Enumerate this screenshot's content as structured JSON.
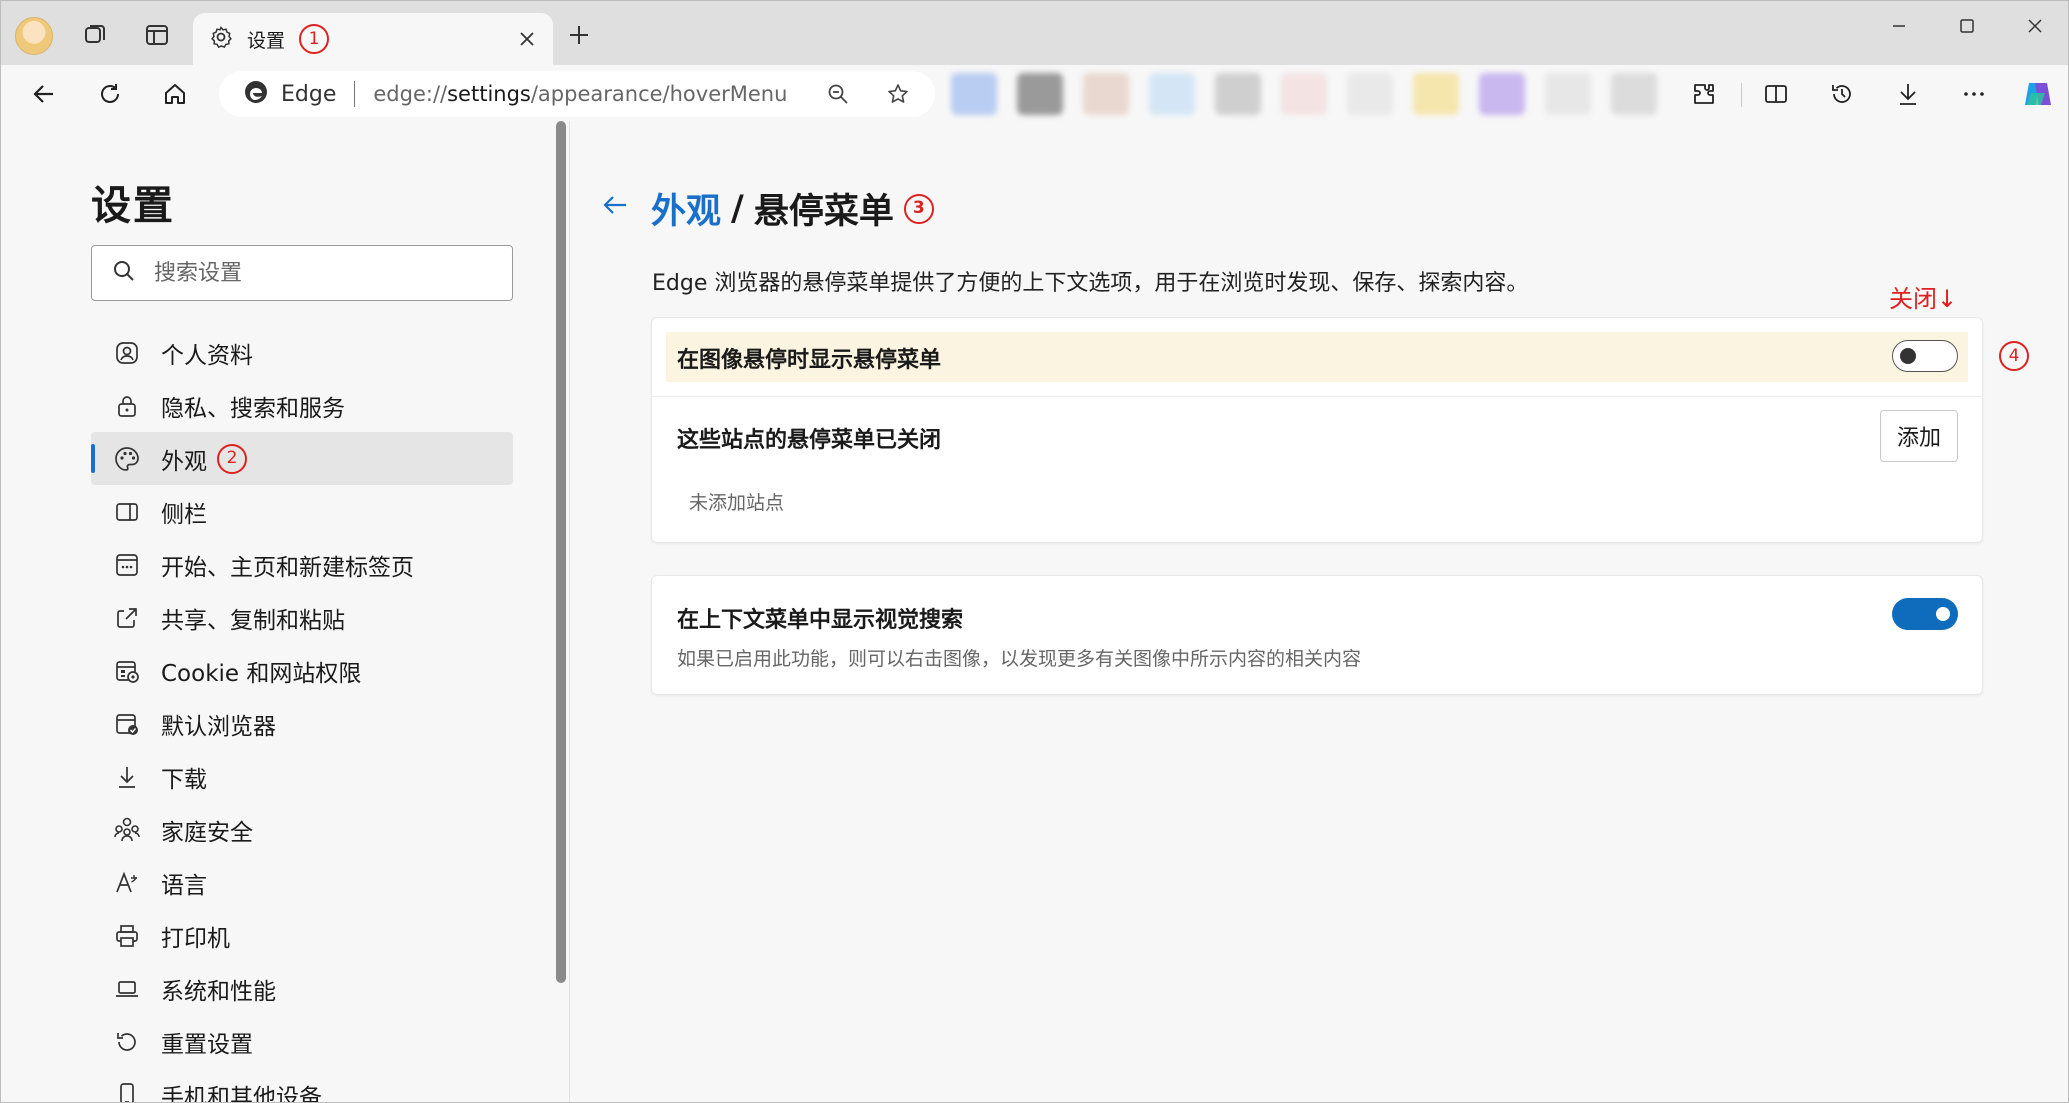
{
  "tab": {
    "title": "设置",
    "callout": "1"
  },
  "address": {
    "site": "Edge",
    "url_scheme": "edge://",
    "url_host": "settings",
    "url_path": "/appearance/hoverMenu"
  },
  "colors": {
    "accent": "#0f6cbd",
    "link": "#1a6fc9",
    "callout": "#dd2222",
    "highlight": "#fbf4e0"
  },
  "sidebar": {
    "title": "设置",
    "search_placeholder": "搜索设置",
    "items": [
      {
        "label": "个人资料",
        "icon": "profile-icon"
      },
      {
        "label": "隐私、搜索和服务",
        "icon": "lock-icon"
      },
      {
        "label": "外观",
        "icon": "palette-icon",
        "active": true,
        "callout": "2"
      },
      {
        "label": "侧栏",
        "icon": "sidebar-icon"
      },
      {
        "label": "开始、主页和新建标签页",
        "icon": "home-page-icon"
      },
      {
        "label": "共享、复制和粘贴",
        "icon": "share-icon"
      },
      {
        "label": "Cookie 和网站权限",
        "icon": "cookie-icon"
      },
      {
        "label": "默认浏览器",
        "icon": "browser-icon"
      },
      {
        "label": "下载",
        "icon": "download-icon"
      },
      {
        "label": "家庭安全",
        "icon": "family-icon"
      },
      {
        "label": "语言",
        "icon": "language-icon"
      },
      {
        "label": "打印机",
        "icon": "printer-icon"
      },
      {
        "label": "系统和性能",
        "icon": "laptop-icon"
      },
      {
        "label": "重置设置",
        "icon": "reset-icon"
      },
      {
        "label": "手机和其他设备",
        "icon": "phone-icon"
      }
    ]
  },
  "main": {
    "breadcrumb_parent": "外观",
    "breadcrumb_sep": "/",
    "breadcrumb_current": "悬停菜单",
    "breadcrumb_callout": "3",
    "description": "Edge 浏览器的悬停菜单提供了方便的上下文选项，用于在浏览时发现、保存、探索内容。",
    "close_note": "关闭↓",
    "card1": {
      "toggle_label": "在图像悬停时显示悬停菜单",
      "toggle_on": false,
      "toggle_callout": "4",
      "sites_label": "这些站点的悬停菜单已关闭",
      "add_button": "添加",
      "empty_text": "未添加站点"
    },
    "card2": {
      "toggle_label": "在上下文菜单中显示视觉搜索",
      "toggle_desc": "如果已启用此功能，则可以右击图像，以发现更多有关图像中所示内容的相关内容",
      "toggle_on": true
    }
  }
}
